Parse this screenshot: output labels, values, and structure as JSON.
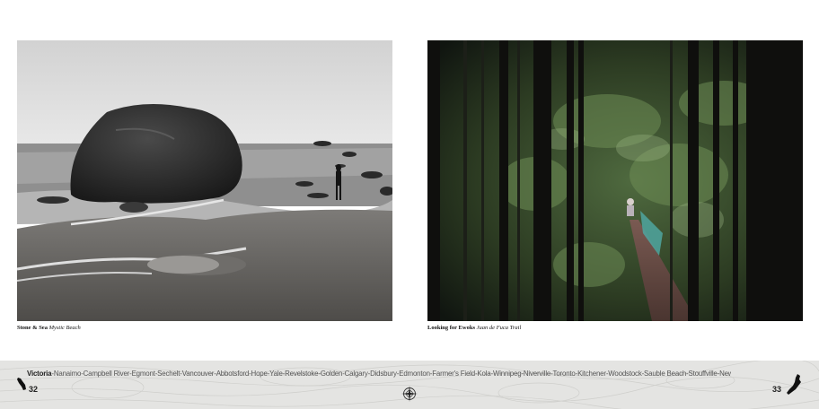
{
  "captions": {
    "left": {
      "title": "Stone & Sea",
      "location": "Mystic Beach"
    },
    "right": {
      "title": "Looking for Ewoks",
      "location": "Juan de Fuca Trail"
    }
  },
  "route": {
    "first": "Victoria",
    "rest": "-Nanaimo-Campbell River-Egmont-Sechelt-Vancouver-Abbotsford-Hope-Yale-Revelstoke-Golden-Calgary-Didsbury-Edmonton-Farmer's Field-Kola-Winnipeg-Niverville-Toronto-Kitchener-Woodstock-Sauble Beach-Stouffville-Newmarket-Orleans-Montreal-Moncton-Halifax"
  },
  "pages": {
    "left": "32",
    "right": "33"
  },
  "icons": {
    "left_map": "vancouver-island-map-icon",
    "right_map": "nova-scotia-map-icon",
    "compass": "compass-rose-icon"
  }
}
